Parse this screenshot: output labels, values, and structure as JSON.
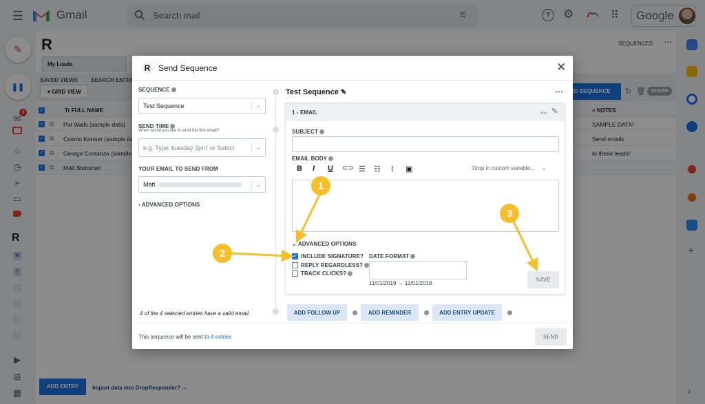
{
  "gmail": {
    "logo_text": "Gmail",
    "search_placeholder": "Search mail",
    "google_text": "Google",
    "inbox_badge": "3"
  },
  "bg": {
    "logo": "R",
    "tab_my_leads": "My Leads",
    "saved_views": "SAVED VIEWS",
    "search_entries": "SEARCH ENTRI",
    "grid_view": "GRID VIEW",
    "col_full_name": "FULL NAME",
    "col_notes": "NOTES",
    "rows": [
      {
        "name": "Pat Walls (sample data)",
        "note": "SAMPLE DATA!"
      },
      {
        "name": "Cosmo Kramer (sample da",
        "note": "Send emails"
      },
      {
        "name": "George Costanza (sample",
        "note": "to these leads!"
      },
      {
        "name": "Matt Steinman",
        "note": ""
      }
    ],
    "sequences_link": "SEQUENCES",
    "send_sequence_btn": "ND SEQUENCE",
    "share": "SHARE",
    "add_entry": "ADD ENTRY",
    "import_link": "Import data into DropResponder? →"
  },
  "modal": {
    "title": "Send Sequence",
    "left": {
      "sequence_label": "SEQUENCE",
      "sequence_value": "Test Sequence",
      "send_time_label": "SEND TIME",
      "send_time_help": "When would you like to send the first email?",
      "send_time_placeholder": "e.g. Type 'tuesday 3pm' or Select",
      "your_email_label": "YOUR EMAIL TO SEND FROM",
      "your_email_value": "Matt",
      "advanced_options": "ADVANCED OPTIONS",
      "valid_note": "4 of the 4 selected entries have a valid email."
    },
    "right": {
      "sequence_name": "Test Sequence",
      "step_title": "1 - EMAIL",
      "subject_label": "SUBJECT",
      "body_label": "EMAIL BODY",
      "drop_variable": "Drop in custom variable...",
      "advanced_options": "ADVANCED OPTIONS",
      "include_signature": "INCLUDE SIGNATURE?",
      "reply_regardless": "REPLY REGARDLESS?",
      "track_clicks": "TRACK CLICKS?",
      "date_format_label": "DATE FORMAT",
      "date_format_example": "11/01/2019 → 11/01/2019",
      "save": "SAVE",
      "add_follow_up": "ADD FOLLOW UP",
      "add_reminder": "ADD REMINDER",
      "add_entry_update": "ADD ENTRY UPDATE"
    },
    "footer_text": "This sequence will be sent to",
    "footer_link": "4 entries",
    "send": "SEND"
  },
  "callouts": [
    "1",
    "2",
    "3"
  ],
  "colors": {
    "accent": "#1a73e8",
    "callout": "#f6bf2a",
    "gmail_red": "#ea4335"
  }
}
